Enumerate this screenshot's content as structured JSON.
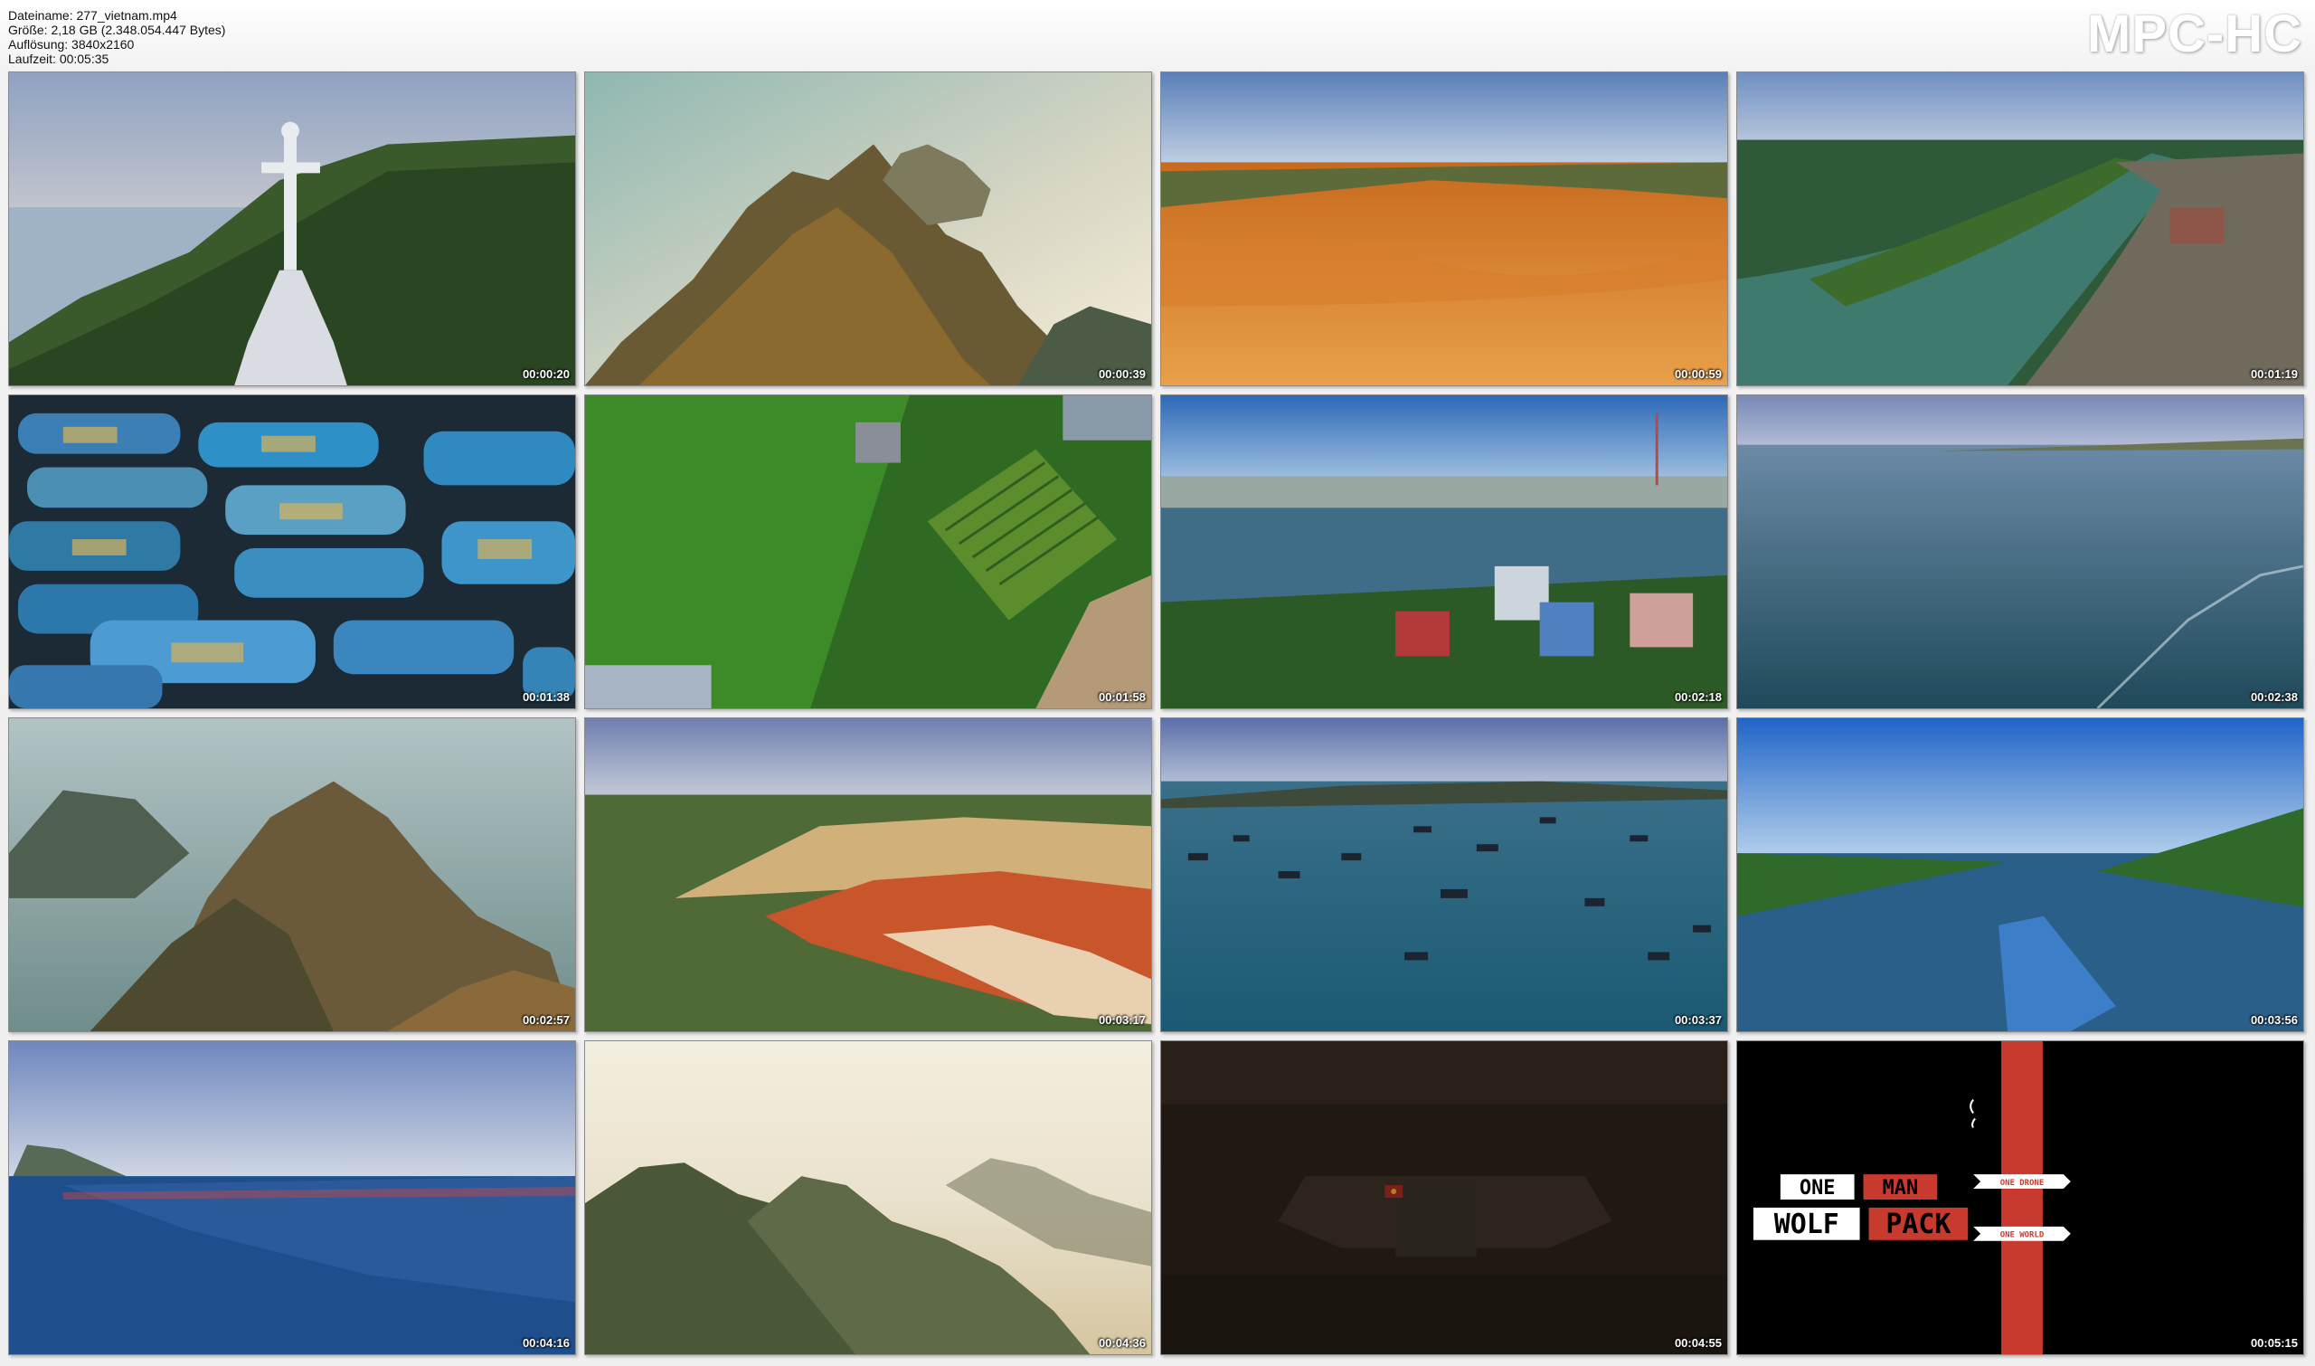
{
  "header": {
    "filename": "Dateiname: 277_vietnam.mp4",
    "size": "Größe: 2,18 GB (2.348.054.447 Bytes)",
    "resolution": "Auflösung: 3840x2160",
    "duration": "Laufzeit: 00:05:35",
    "brand": "MPC-HC"
  },
  "thumbnails": [
    {
      "time": "00:00:20",
      "scene": "statue-coast"
    },
    {
      "time": "00:00:39",
      "scene": "karst-misty"
    },
    {
      "time": "00:00:59",
      "scene": "sand-dunes"
    },
    {
      "time": "00:01:19",
      "scene": "river-town"
    },
    {
      "time": "00:01:38",
      "scene": "fishing-boats-top"
    },
    {
      "time": "00:01:58",
      "scene": "palm-farm"
    },
    {
      "time": "00:02:18",
      "scene": "river-city"
    },
    {
      "time": "00:02:38",
      "scene": "open-water"
    },
    {
      "time": "00:02:57",
      "scene": "karst-bay"
    },
    {
      "time": "00:03:17",
      "scene": "red-canyon"
    },
    {
      "time": "00:03:37",
      "scene": "boats-bay"
    },
    {
      "time": "00:03:56",
      "scene": "river-barge"
    },
    {
      "time": "00:04:16",
      "scene": "harbor-boats"
    },
    {
      "time": "00:04:36",
      "scene": "karst-sunrise"
    },
    {
      "time": "00:04:55",
      "scene": "dark-square"
    },
    {
      "time": "00:05:15",
      "scene": "logo-card"
    }
  ],
  "logo_card": {
    "line1_a": "ONE",
    "line1_b": "MAN",
    "line2_a": "WOLF",
    "line2_b": "PACK",
    "ribbon_top": "ONE DRONE",
    "ribbon_bottom": "ONE WORLD"
  },
  "colors": {
    "accent_red": "#c83a2e",
    "timestamp": "#ffffff"
  }
}
